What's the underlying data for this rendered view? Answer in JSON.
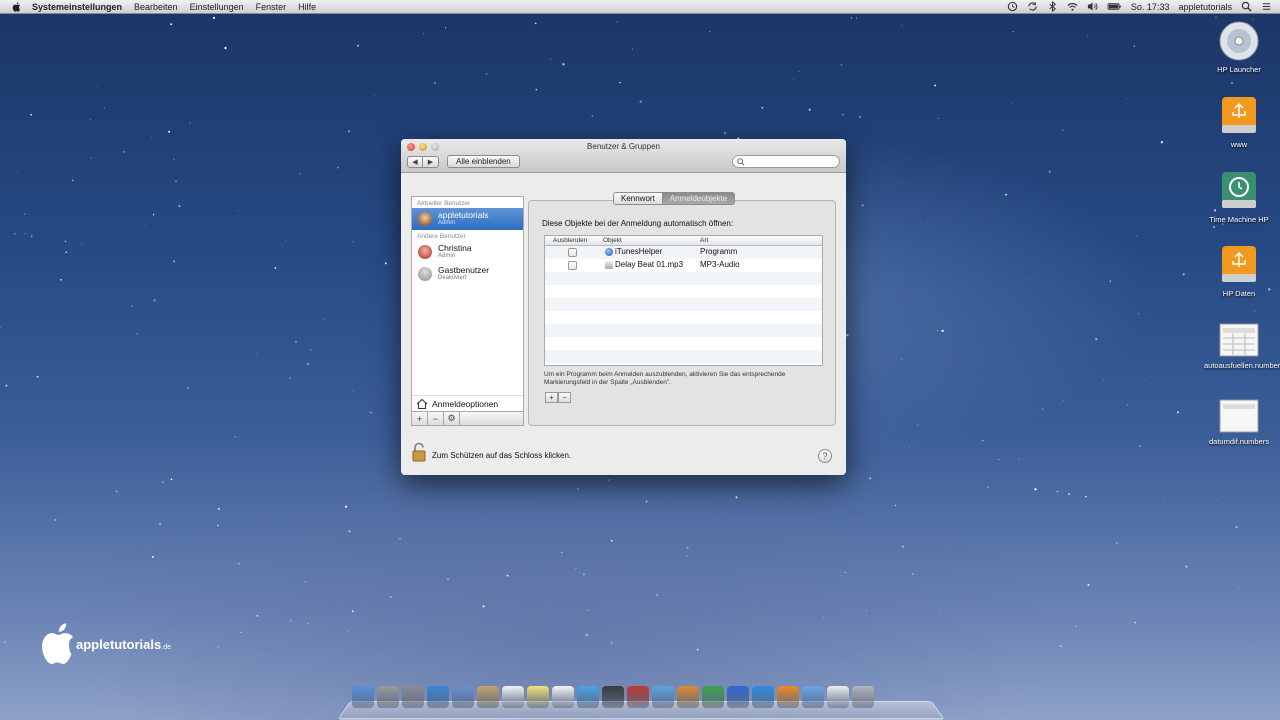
{
  "menubar": {
    "app_name": "Systemeinstellungen",
    "menus": [
      "Bearbeiten",
      "Einstellungen",
      "Fenster",
      "Hilfe"
    ],
    "clock": "So. 17:33",
    "user": "appletutorials",
    "icons": [
      "time-machine-icon",
      "sync-icon",
      "bluetooth-icon",
      "wifi-icon",
      "volume-icon",
      "battery-icon",
      "search-icon"
    ]
  },
  "window": {
    "title": "Benutzer & Gruppen",
    "show_all": "Alle einblenden",
    "search_placeholder": "",
    "sidebar": {
      "current_header": "Aktueller Benutzer",
      "current_user": {
        "name": "appletutorials",
        "role": "Admin"
      },
      "other_header": "Andere Benutzer",
      "other_users": [
        {
          "name": "Christina",
          "role": "Admin"
        },
        {
          "name": "Gastbenutzer",
          "role": "Deaktiviert"
        }
      ],
      "login_options": "Anmeldeoptionen"
    },
    "tabs": [
      "Kennwort",
      "Anmeldeobjekte"
    ],
    "active_tab": "Anmeldeobjekte",
    "login_items_title": "Diese Objekte bei der Anmeldung automatisch öffnen:",
    "columns": [
      "Ausblenden",
      "Objekt",
      "Art"
    ],
    "items": [
      {
        "name": "iTunesHelper",
        "kind": "Programm",
        "hidden": false
      },
      {
        "name": "Delay Beat 01.mp3",
        "kind": "MP3-Audio",
        "hidden": false
      }
    ],
    "hint": "Um ein Programm beim Anmelden auszublenden, aktivieren Sie das entsprechende Markierungsfeld in der Spalte „Ausblenden\".",
    "lock_text": "Zum Schützen auf das Schloss klicken.",
    "help": "?"
  },
  "desktop_icons": [
    {
      "label": "HP Launcher",
      "icon": "cd-icon"
    },
    {
      "label": "www",
      "icon": "usb-drive-icon"
    },
    {
      "label": "Time Machine HP",
      "icon": "time-machine-drive-icon"
    },
    {
      "label": "HP Daten",
      "icon": "usb-drive-icon"
    },
    {
      "label": "autoausfuellen.numbers",
      "icon": "numbers-file-icon"
    },
    {
      "label": "datumdif.numbers",
      "icon": "numbers-file-icon"
    }
  ],
  "watermark": {
    "brand": "appletutorials",
    "suffix": ".de"
  },
  "dock_apps": [
    "finder-icon",
    "launchpad-icon",
    "system-prefs-icon",
    "safari-icon",
    "preview-icon",
    "contacts-icon",
    "calendar-icon",
    "notes-icon",
    "reminders-icon",
    "messages-icon",
    "facetime-icon",
    "photobooth-icon",
    "itunes-icon",
    "pages-icon",
    "numbers-icon",
    "keynote-icon",
    "appstore-icon",
    "ibooks-icon",
    "mail-icon",
    "document-icon",
    "trash-icon"
  ],
  "colors": {
    "selection": "#2f6cc0",
    "desktop": "#274a85"
  }
}
